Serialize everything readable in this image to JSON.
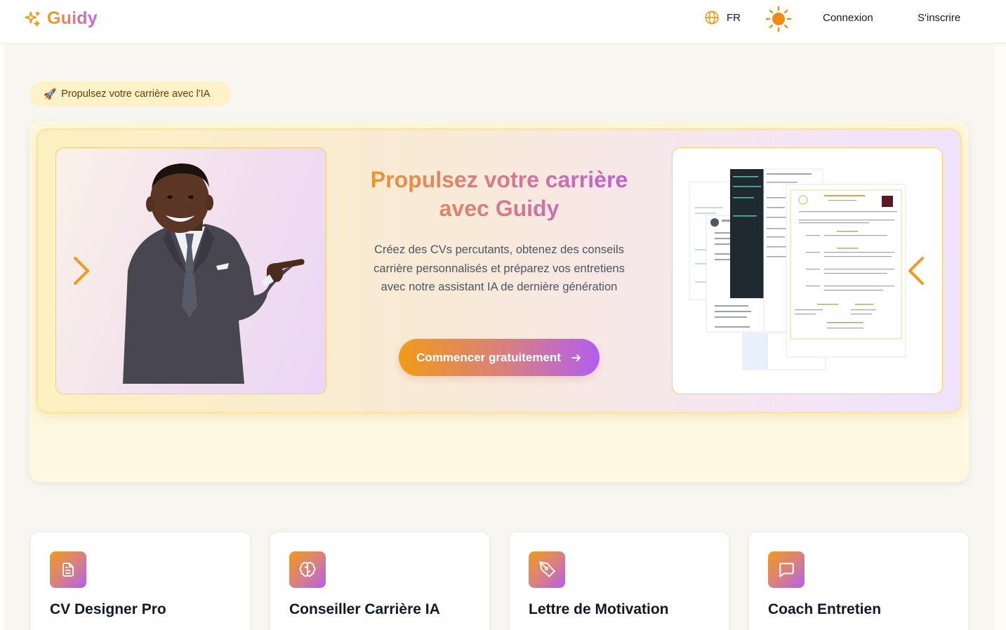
{
  "brand": {
    "name": "Guidy"
  },
  "header": {
    "language": "FR",
    "login": "Connexion",
    "signup": "S'inscrire"
  },
  "badge": {
    "emoji": "🚀",
    "text": "Propulsez votre carrière avec l'IA"
  },
  "hero": {
    "title_line1": "Propulsez votre carrière",
    "title_line2": "avec Guidy",
    "description": "Créez des CVs percutants, obtenez des conseils carrière personnalisés et préparez vos entretiens avec notre assistant IA de dernière génération",
    "cta": "Commencer gratuitement"
  },
  "features": [
    {
      "title": "CV Designer Pro",
      "icon": "document-icon"
    },
    {
      "title": "Conseiller Carrière IA",
      "icon": "brain-icon"
    },
    {
      "title": "Lettre de Motivation",
      "icon": "pen-tool-icon"
    },
    {
      "title": "Coach Entretien",
      "icon": "message-icon"
    }
  ],
  "colors": {
    "accent_orange": "#f09a1c",
    "accent_purple": "#b25ef0",
    "badge_bg": "#fdf2c8"
  }
}
